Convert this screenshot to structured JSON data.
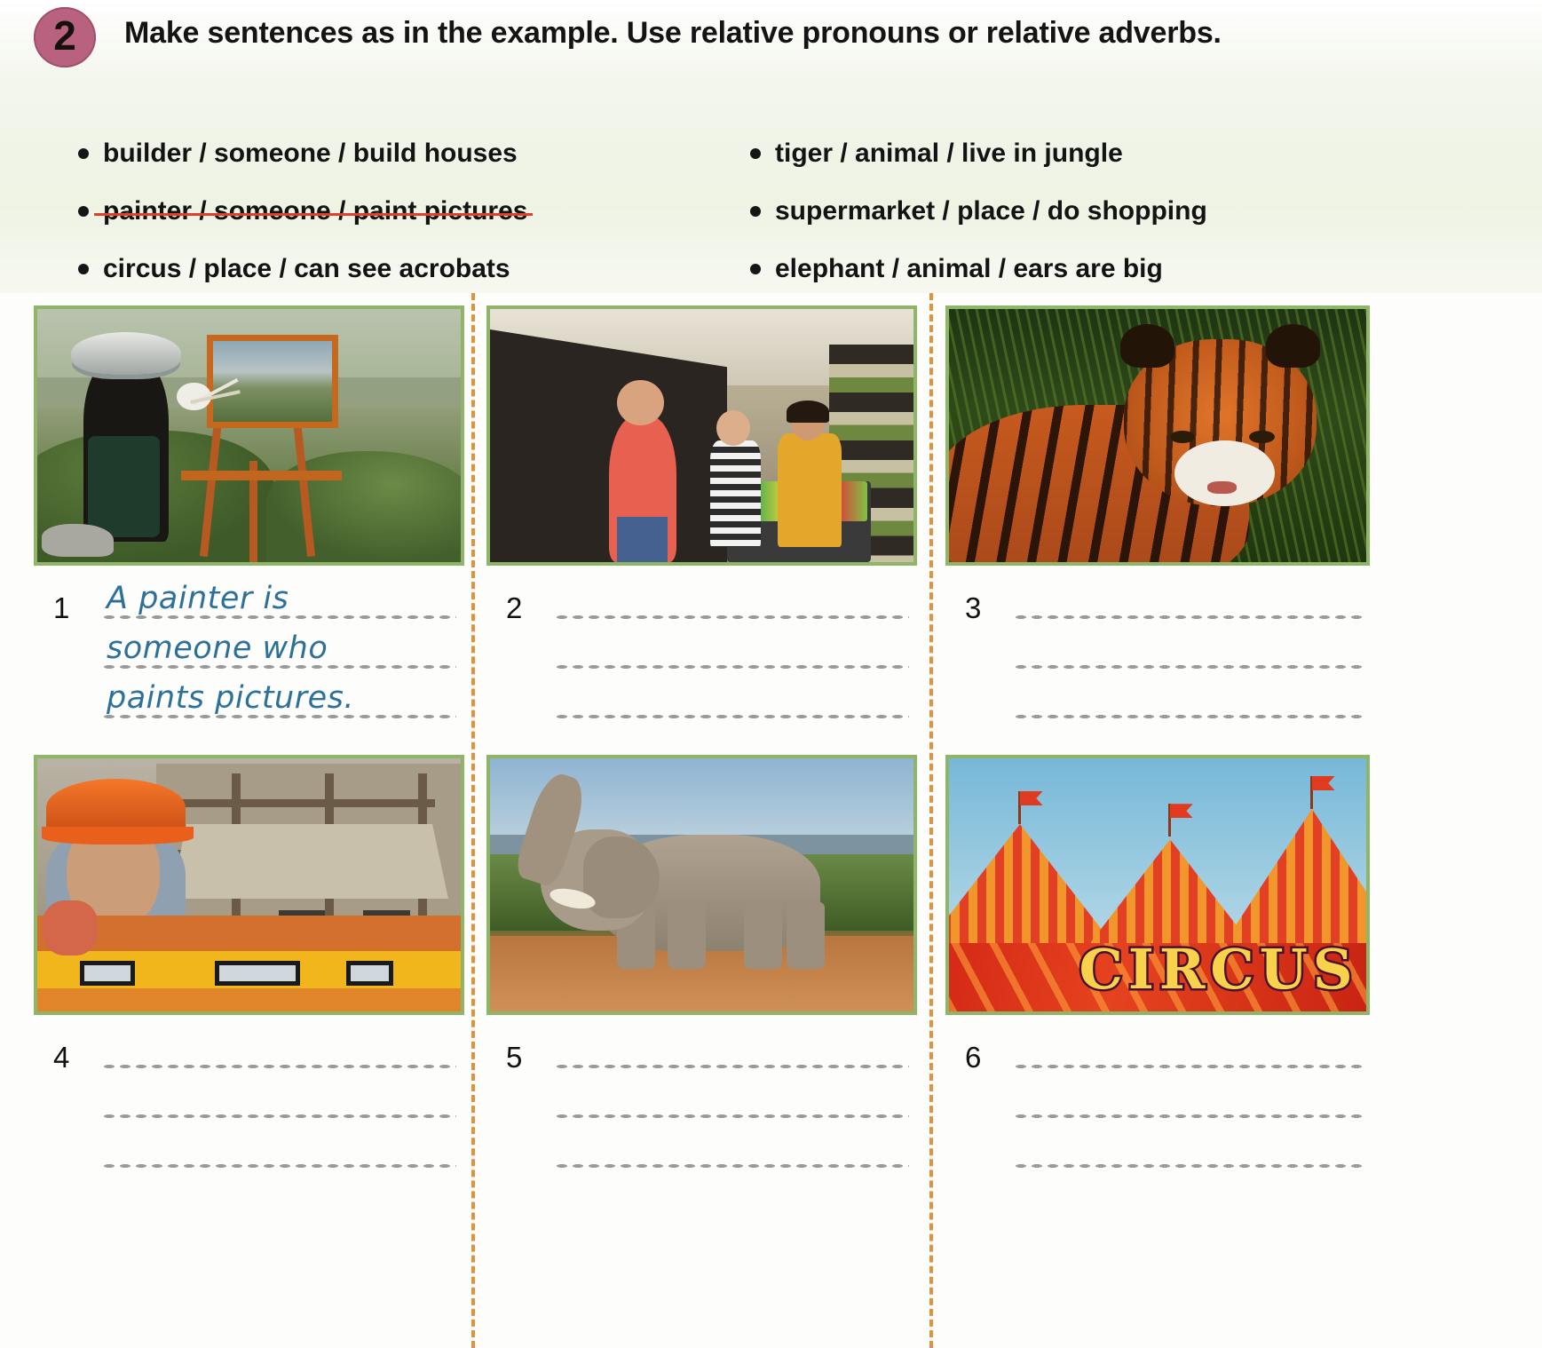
{
  "exercise": {
    "number": "2",
    "instruction": "Make sentences as in the example. Use relative pronouns or relative adverbs."
  },
  "cues": {
    "left": [
      {
        "text": "builder / someone / build houses",
        "struck": false
      },
      {
        "text": "painter / someone / paint pictures",
        "struck": true
      },
      {
        "text": "circus / place / can see acrobats",
        "struck": false
      }
    ],
    "right": [
      {
        "text": "tiger / animal / live in jungle",
        "struck": false
      },
      {
        "text": "supermarket / place / do shopping",
        "struck": false
      },
      {
        "text": "elephant / animal / ears are big",
        "struck": false
      }
    ]
  },
  "items": [
    {
      "number": "1",
      "image_alt": "painter at easel painting landscape outdoors",
      "answer_lines": [
        "A painter is",
        "someone who",
        "paints pictures."
      ]
    },
    {
      "number": "2",
      "image_alt": "family shopping in a supermarket aisle with trolley",
      "answer_lines": [
        "",
        "",
        ""
      ]
    },
    {
      "number": "3",
      "image_alt": "tiger crouching in green grass",
      "answer_lines": [
        "",
        "",
        ""
      ]
    },
    {
      "number": "4",
      "image_alt": "builder wearing orange hard hat holding a spirit level at a house site",
      "answer_lines": [
        "",
        "",
        ""
      ]
    },
    {
      "number": "5",
      "image_alt": "elephant with raised trunk standing on red earth",
      "answer_lines": [
        "",
        "",
        ""
      ]
    },
    {
      "number": "6",
      "image_alt": "red and orange striped circus tents with CIRCUS banner",
      "answer_lines": [
        "",
        "",
        ""
      ]
    }
  ],
  "circus_sign": "CIRCUS",
  "colors": {
    "number_badge": "#b9627f",
    "strikethrough": "#e0402b",
    "handwriting": "#2d7099",
    "photo_border": "#8fb569",
    "column_divider": "#e2923a",
    "band_background": "#eef3e4",
    "dot_line": "#9a9a9a"
  }
}
